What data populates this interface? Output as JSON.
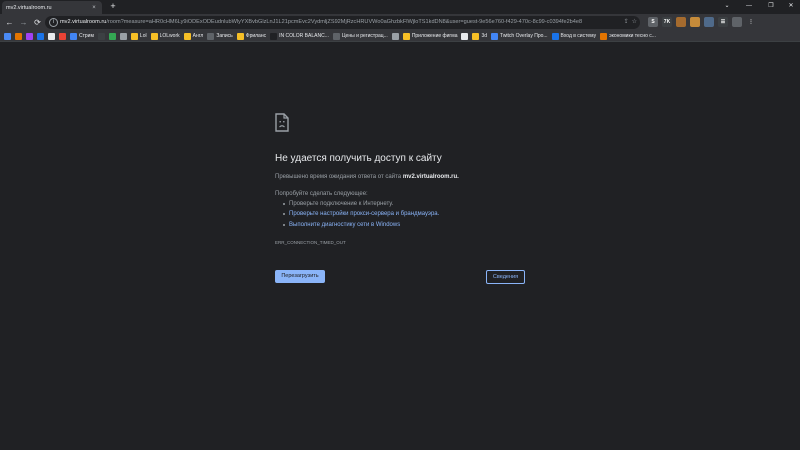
{
  "tab": {
    "title": "mv2.virtualroom.ru",
    "close": "×",
    "new_tab": "+"
  },
  "window": {
    "chevron": "⌄",
    "minimize": "—",
    "maximize": "❐",
    "close": "✕"
  },
  "toolbar": {
    "back": "←",
    "forward": "→",
    "reload": "⟳",
    "url_host": "mv2.virtualroom.ru",
    "url_path": "/room?measure=aHR0cHM6Ly9iODExODEudnlubWlyYXBvbGlzLnJ1L21pcmEvc2VydmljZS92MjRzcHRUVWo0aGhzbkFlWjloTS1kdDN8&user=guest-9e56e760-f429-470c-8c99-c0394fe2b4e8"
  },
  "extensions": [
    {
      "label": "S",
      "color": "#5f6368"
    },
    {
      "label": "7K",
      "color": "#3c4043"
    },
    {
      "label": "",
      "color": "#a56b2e"
    },
    {
      "label": "",
      "color": "#c58b3a"
    },
    {
      "label": "",
      "color": "#4f6a8a"
    },
    {
      "label": "☰",
      "color": "#3c4043"
    },
    {
      "label": "",
      "color": "#5f6368"
    },
    {
      "label": "⋮",
      "color": "#35363a"
    }
  ],
  "bookmarks": [
    {
      "label": "",
      "color": "#4a8af4"
    },
    {
      "label": "",
      "color": "#e37400"
    },
    {
      "label": "",
      "color": "#a142f4"
    },
    {
      "label": "",
      "color": "#1a73e8"
    },
    {
      "label": "",
      "color": "#e8eaed"
    },
    {
      "label": "",
      "color": "#ea4335"
    },
    {
      "label": "Стрим",
      "color": "#4285f4"
    },
    {
      "label": "",
      "color": "#3c4043"
    },
    {
      "label": "",
      "color": "#34a853"
    },
    {
      "label": "",
      "color": "#9aa0a6"
    },
    {
      "label": "Lol",
      "color": "#f6bf26"
    },
    {
      "label": "LOLwork",
      "color": "#f6bf26"
    },
    {
      "label": "Англ",
      "color": "#f6bf26"
    },
    {
      "label": "Запись",
      "color": "#5f6368"
    },
    {
      "label": "Фриланс",
      "color": "#f6bf26"
    },
    {
      "label": "IN COLOR BALANC...",
      "color": "#202124"
    },
    {
      "label": "Цены и регистрац...",
      "color": "#5f6368"
    },
    {
      "label": "",
      "color": "#9aa0a6"
    },
    {
      "label": "Приложение фигма",
      "color": "#f6bf26"
    },
    {
      "label": "",
      "color": "#e8eaed"
    },
    {
      "label": "3d",
      "color": "#f6bf26"
    },
    {
      "label": "Twitch Overlay Про...",
      "color": "#4285f4"
    },
    {
      "label": "Вход в систему",
      "color": "#1a73e8"
    },
    {
      "label": "экономики тесно с...",
      "color": "#e37400"
    }
  ],
  "error": {
    "title": "Не удается получить доступ к сайту",
    "desc_prefix": "Превышено время ожидания ответа от сайта ",
    "desc_host": "mv2.virtualroom.ru.",
    "try": "Попробуйте сделать следующее:",
    "suggestions": [
      "Проверьте подключение к Интернету.",
      "Проверьте настройки прокси-сервера и брандмауэра.",
      "Выполните диагностику сети в Windows"
    ],
    "code": "ERR_CONNECTION_TIMED_OUT",
    "reload_button": "Перезагрузить",
    "details_button": "Сведения"
  }
}
